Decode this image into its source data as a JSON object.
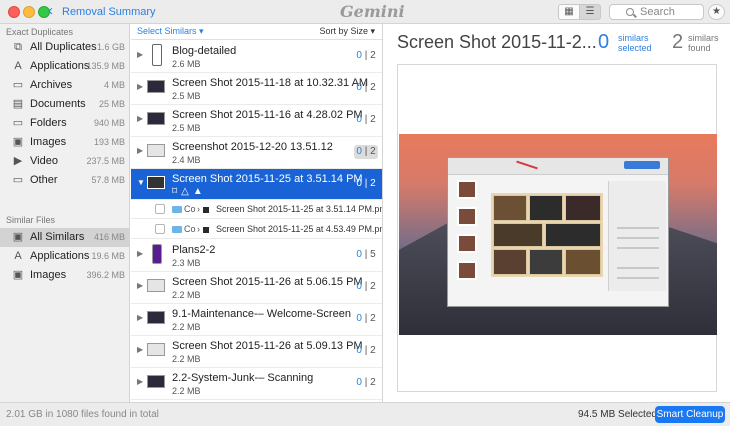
{
  "titlebar": {
    "breadcrumb": "Removal Summary",
    "app_name": "Gemini",
    "search_placeholder": "Search"
  },
  "sidebar": {
    "exact_title": "Exact Duplicates",
    "exact_items": [
      {
        "label": "All Duplicates",
        "size": "1.6 GB",
        "icon": "copy-icon",
        "glyph": "⧉"
      },
      {
        "label": "Applications",
        "size": "135.9 MB",
        "icon": "applications-icon",
        "glyph": "A"
      },
      {
        "label": "Archives",
        "size": "4 MB",
        "icon": "archive-icon",
        "glyph": "▭"
      },
      {
        "label": "Documents",
        "size": "25 MB",
        "icon": "document-icon",
        "glyph": "▤"
      },
      {
        "label": "Folders",
        "size": "940 MB",
        "icon": "folder-icon",
        "glyph": "▭"
      },
      {
        "label": "Images",
        "size": "193 MB",
        "icon": "image-icon",
        "glyph": "▣"
      },
      {
        "label": "Video",
        "size": "237.5 MB",
        "icon": "video-icon",
        "glyph": "▶"
      },
      {
        "label": "Other",
        "size": "57.8 MB",
        "icon": "other-icon",
        "glyph": "▭"
      }
    ],
    "similar_title": "Similar Files",
    "similar_items": [
      {
        "label": "All Similars",
        "size": "416 MB",
        "icon": "similars-icon",
        "glyph": "▣"
      },
      {
        "label": "Applications",
        "size": "19.6 MB",
        "icon": "applications-icon",
        "glyph": "A"
      },
      {
        "label": "Images",
        "size": "396.2 MB",
        "icon": "image-icon",
        "glyph": "▣"
      }
    ]
  },
  "list": {
    "select_similars": "Select Similars ▾",
    "sort_label": "Sort by Size ▾",
    "rows": [
      {
        "name": "Blog-detailed",
        "size": "2.6 MB",
        "selected_count": "0",
        "total": "2",
        "thumb": "phone"
      },
      {
        "name": "Screen Shot 2015-11-18 at 10.32.31 AM",
        "size": "2.5 MB",
        "selected_count": "0",
        "total": "2",
        "thumb": "dark"
      },
      {
        "name": "Screen Shot 2015-11-16 at 4.28.02 PM",
        "size": "2.5 MB",
        "selected_count": "0",
        "total": "2",
        "thumb": "dark"
      },
      {
        "name": "Screenshot 2015-12-20 13.51.12",
        "size": "2.4 MB",
        "selected_count": "0",
        "total": "2",
        "thumb": "light",
        "boxed": true
      },
      {
        "name": "Screen Shot 2015-11-25 at 3.51.14 PM",
        "size": "",
        "selected_count": "0",
        "total": "2",
        "thumb": "dark",
        "selected": true
      },
      {
        "name": "Plans2-2",
        "size": "2.3 MB",
        "selected_count": "0",
        "total": "5",
        "thumb": "purple"
      },
      {
        "name": "Screen Shot 2015-11-26 at 5.06.15 PM",
        "size": "2.2 MB",
        "selected_count": "0",
        "total": "2",
        "thumb": "light"
      },
      {
        "name": "9.1-Maintenance-– Welcome-Screen",
        "size": "2.2 MB",
        "selected_count": "0",
        "total": "2",
        "thumb": "dark"
      },
      {
        "name": "Screen Shot 2015-11-26 at 5.09.13 PM",
        "size": "2.2 MB",
        "selected_count": "0",
        "total": "2",
        "thumb": "light"
      },
      {
        "name": "2.2-System-Junk-– Scanning",
        "size": "2.2 MB",
        "selected_count": "0",
        "total": "2",
        "thumb": "dark"
      }
    ],
    "subrows": [
      {
        "path": "Co",
        "name": "Screen Shot 2015-11-25 at 3.51.14 PM.png"
      },
      {
        "path": "Co",
        "name": "Screen Shot 2015-11-25 at 4.53.49 PM.png"
      }
    ],
    "count_separator": "|"
  },
  "preview": {
    "title": "Screen Shot 2015-11-2...",
    "selected_num": "0",
    "selected_label_1": "similars",
    "selected_label_2": "selected",
    "found_num": "2",
    "found_label_1": "similars",
    "found_label_2": "found"
  },
  "status": {
    "summary": "2.01 GB in 1080 files found in total",
    "selected": "94.5 MB Selected",
    "cleanup": "Smart Cleanup"
  }
}
